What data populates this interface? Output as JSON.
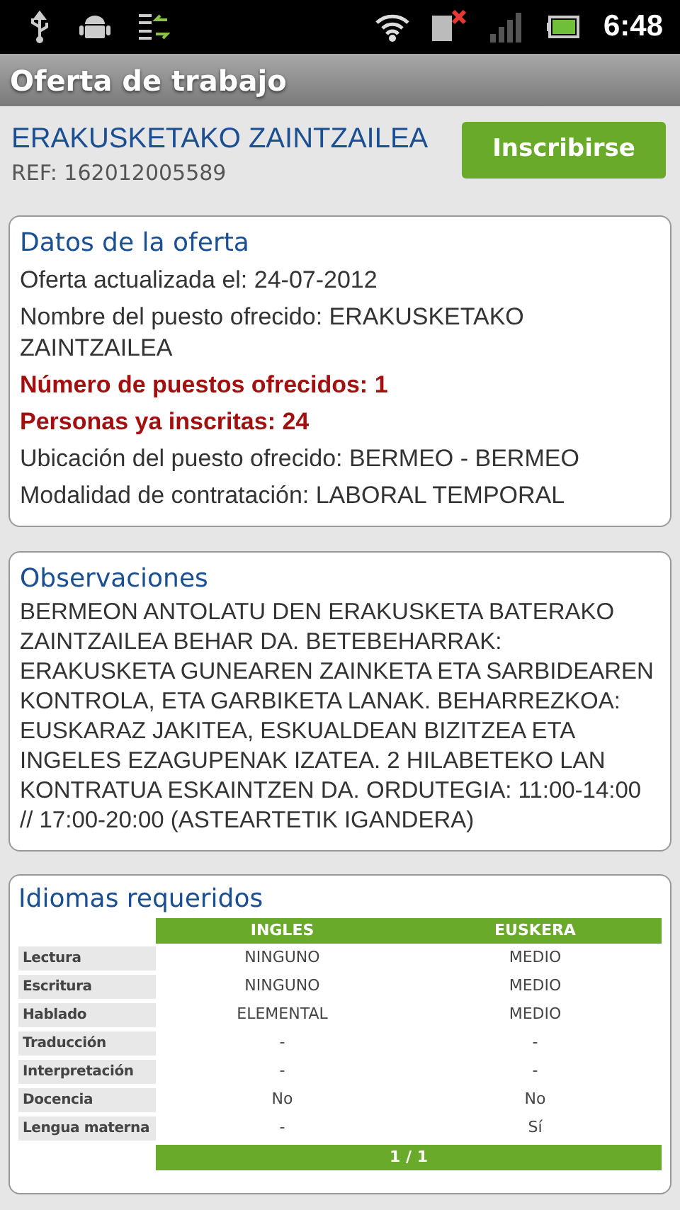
{
  "status_bar": {
    "time": "6:48"
  },
  "title_bar": {
    "title": "Oferta de trabajo"
  },
  "header": {
    "job_title": "ERAKUSKETAKO ZAINTZAILEA",
    "ref": "REF: 162012005589",
    "button": "Inscribirse"
  },
  "offer_details": {
    "title": "Datos de la oferta",
    "lines": [
      {
        "text": "Oferta actualizada el: 24-07-2012",
        "emphasis": false
      },
      {
        "text": "Nombre del puesto ofrecido: ERAKUSKETAKO ZAINTZAILEA",
        "emphasis": false
      },
      {
        "text": "Número de puestos ofrecidos: 1",
        "emphasis": true
      },
      {
        "text": "Personas ya inscritas: 24",
        "emphasis": true
      },
      {
        "text": "Ubicación del puesto ofrecido: BERMEO - BERMEO",
        "emphasis": false
      },
      {
        "text": "Modalidad de contratación: LABORAL TEMPORAL",
        "emphasis": false
      }
    ]
  },
  "observations": {
    "title": "Observaciones",
    "text": "BERMEON ANTOLATU DEN ERAKUSKETA BATERAKO ZAINTZAILEA BEHAR DA. BETEBEHARRAK: ERAKUSKETA GUNEAREN ZAINKETA ETA SARBIDEAREN KONTROLA, ETA GARBIKETA LANAK. BEHARREZKOA: EUSKARAZ JAKITEA, ESKUALDEAN BIZITZEA ETA INGELES EZAGUPENAK IZATEA. 2 HILABETEKO LAN KONTRATUA ESKAINTZEN DA. ORDUTEGIA: 11:00-14:00 // 17:00-20:00 (ASTEARTETIK IGANDERA)"
  },
  "languages": {
    "title": "Idiomas requeridos",
    "table": {
      "columns": [
        "INGLES",
        "EUSKERA"
      ],
      "rows": [
        {
          "label": "Lectura",
          "cells": [
            "NINGUNO",
            "MEDIO"
          ]
        },
        {
          "label": "Escritura",
          "cells": [
            "NINGUNO",
            "MEDIO"
          ]
        },
        {
          "label": "Hablado",
          "cells": [
            "ELEMENTAL",
            "MEDIO"
          ]
        },
        {
          "label": "Traducción",
          "cells": [
            "-",
            "-"
          ]
        },
        {
          "label": "Interpretación",
          "cells": [
            "-",
            "-"
          ]
        },
        {
          "label": "Docencia",
          "cells": [
            "No",
            "No"
          ]
        },
        {
          "label": "Lengua materna",
          "cells": [
            "-",
            "Sí"
          ]
        }
      ],
      "pager": "1 / 1"
    }
  }
}
